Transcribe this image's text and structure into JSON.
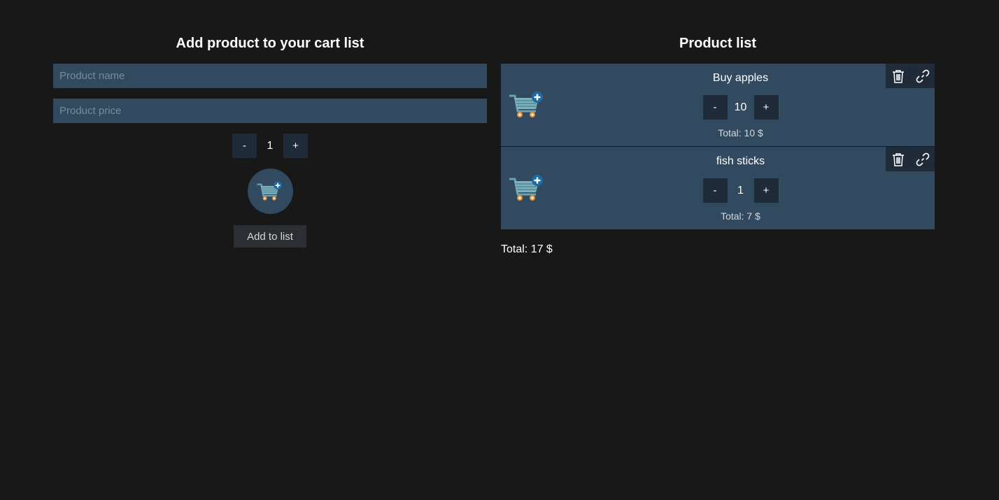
{
  "add_form": {
    "title": "Add product to your cart list",
    "name_placeholder": "Product name",
    "price_placeholder": "Product price",
    "minus_label": "-",
    "plus_label": "+",
    "quantity": "1",
    "add_button_label": "Add to list",
    "cart_icon": "cart-plus-icon"
  },
  "product_list": {
    "title": "Product list",
    "items": [
      {
        "name": "Buy apples",
        "quantity": "10",
        "minus_label": "-",
        "plus_label": "+",
        "total": "Total: 10 $"
      },
      {
        "name": "fish sticks",
        "quantity": "1",
        "minus_label": "-",
        "plus_label": "+",
        "total": "Total: 7 $"
      }
    ],
    "grand_total": "Total: 17 $"
  },
  "icons": {
    "delete": "trash-icon",
    "link": "link-icon",
    "cart": "cart-plus-icon"
  },
  "colors": {
    "background": "#181818",
    "panel": "#324a5f",
    "button": "#1f2b38"
  }
}
